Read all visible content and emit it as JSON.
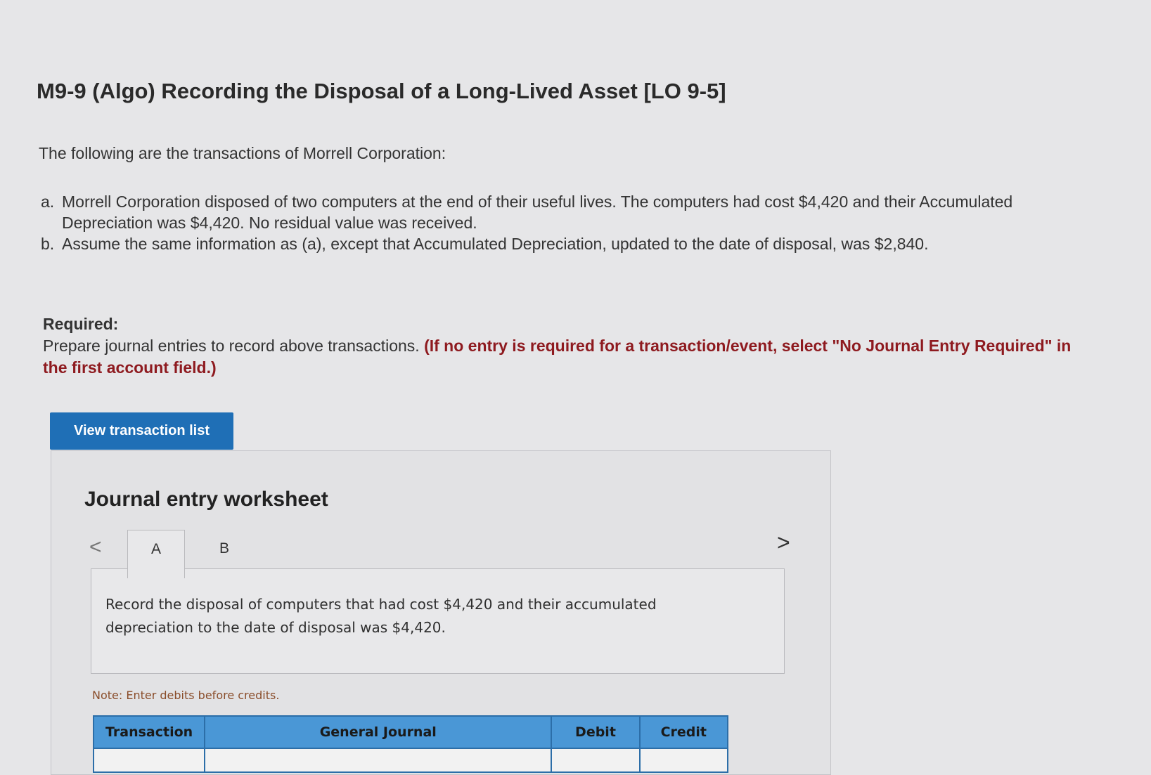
{
  "problem": {
    "title": "M9-9 (Algo) Recording the Disposal of a Long-Lived Asset [LO 9-5]",
    "intro": "The following are the transactions of Morrell Corporation:",
    "items": [
      {
        "marker": "a.",
        "text": "Morrell Corporation disposed of two computers at the end of their useful lives. The computers had cost $4,420 and their Accumulated Depreciation was $4,420. No residual value was received."
      },
      {
        "marker": "b.",
        "text": "Assume the same information as (a), except that Accumulated Depreciation, updated to the date of disposal, was $2,840."
      }
    ],
    "required_heading": "Required:",
    "required_text": "Prepare journal entries to record above transactions.",
    "required_note": "(If no entry is required for a transaction/event, select \"No Journal Entry Required\" in the first account field.)"
  },
  "view_button_label": "View transaction list",
  "worksheet": {
    "title": "Journal entry worksheet",
    "prev_icon": "<",
    "next_icon": ">",
    "tabs": [
      "A",
      "B"
    ],
    "description": "Record the disposal of computers that had cost $4,420 and their accumulated depreciation to the date of disposal was $4,420.",
    "note": "Note: Enter debits before credits.",
    "columns": [
      "Transaction",
      "General Journal",
      "Debit",
      "Credit"
    ]
  },
  "colors": {
    "button": "#1f6fb6",
    "table_header": "#4a97d6",
    "required_note": "#8e1a1f"
  }
}
